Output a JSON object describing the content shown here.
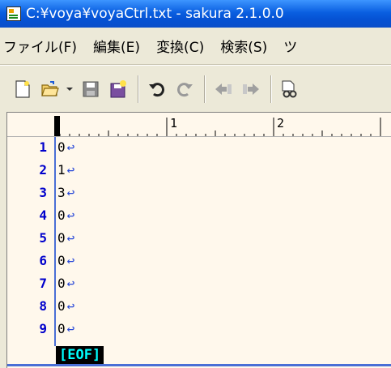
{
  "window": {
    "title": "C:¥voya¥voyaCtrl.txt - sakura 2.1.0.0"
  },
  "menu": {
    "items": [
      {
        "label": "ファイル(F)"
      },
      {
        "label": "編集(E)"
      },
      {
        "label": "変換(C)"
      },
      {
        "label": "検索(S)"
      },
      {
        "label": "ツ"
      }
    ]
  },
  "toolbar": {
    "icons": [
      "new-file-icon",
      "open-folder-icon",
      "dropdown-arrow-icon",
      "save-icon",
      "save-all-icon",
      "undo-icon",
      "redo-icon",
      "jump-back-icon",
      "jump-forward-icon",
      "search-file-icon"
    ]
  },
  "ruler": {
    "marks": [
      "1",
      "2"
    ]
  },
  "editor": {
    "lines": [
      {
        "num": "1",
        "text": "0"
      },
      {
        "num": "2",
        "text": "1"
      },
      {
        "num": "3",
        "text": "3"
      },
      {
        "num": "4",
        "text": "0"
      },
      {
        "num": "5",
        "text": "0"
      },
      {
        "num": "6",
        "text": "0"
      },
      {
        "num": "7",
        "text": "0"
      },
      {
        "num": "8",
        "text": "0"
      },
      {
        "num": "9",
        "text": "0"
      }
    ],
    "eol_mark": "↩",
    "eof_label": "[EOF]"
  },
  "colors": {
    "titlebar": "#0a5fe0",
    "editor_bg": "#fff8ec",
    "line_number": "#0000cc",
    "eof_text": "#00ffff"
  }
}
